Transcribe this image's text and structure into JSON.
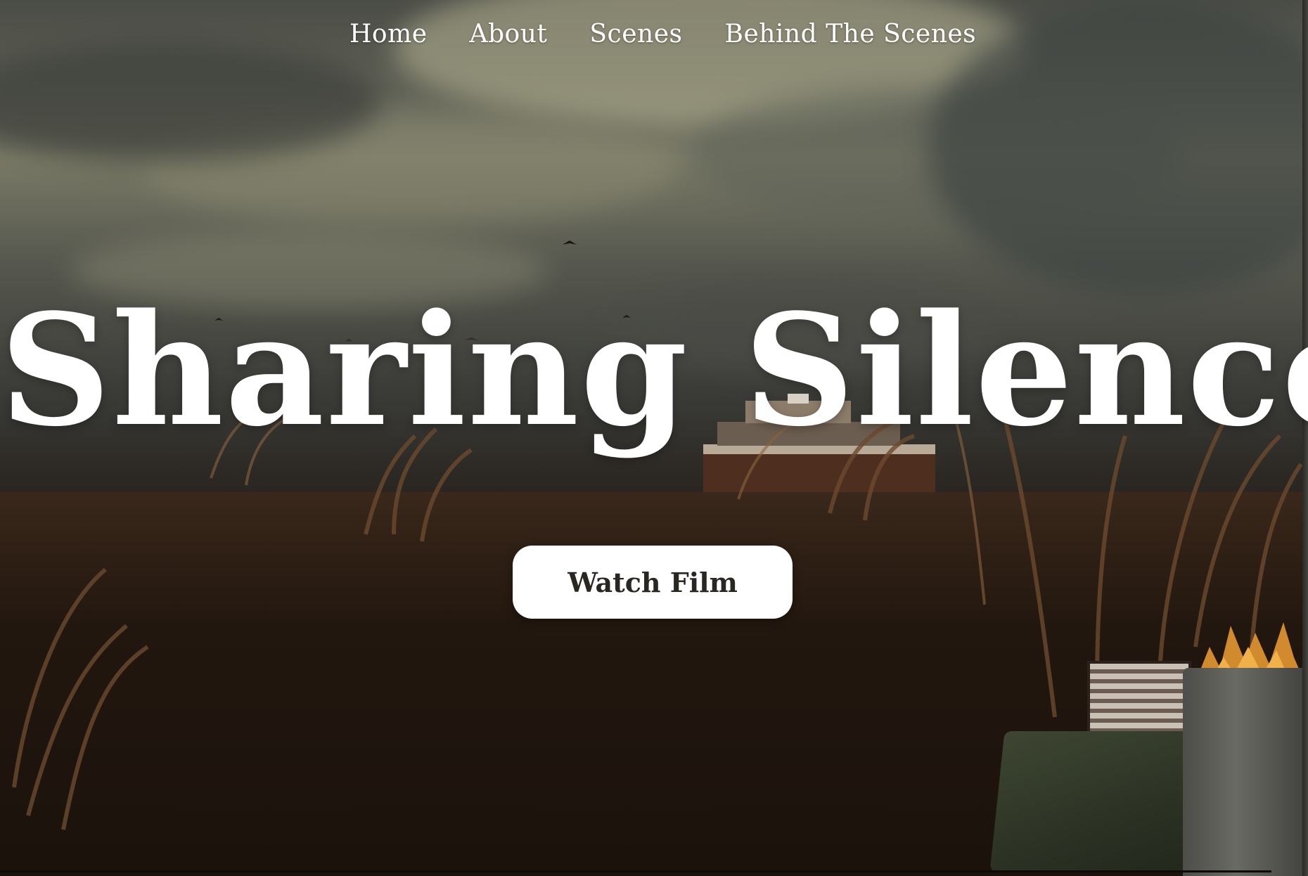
{
  "nav": {
    "items": [
      {
        "label": "Home"
      },
      {
        "label": "About"
      },
      {
        "label": "Scenes"
      },
      {
        "label": "Behind The Scenes"
      }
    ]
  },
  "hero": {
    "title": "Sharing Silence",
    "cta_label": "Watch Film"
  },
  "colors": {
    "text": "#ffffff",
    "button_bg": "#ffffff",
    "button_text": "#2a2621",
    "ground": "#1d140e"
  }
}
